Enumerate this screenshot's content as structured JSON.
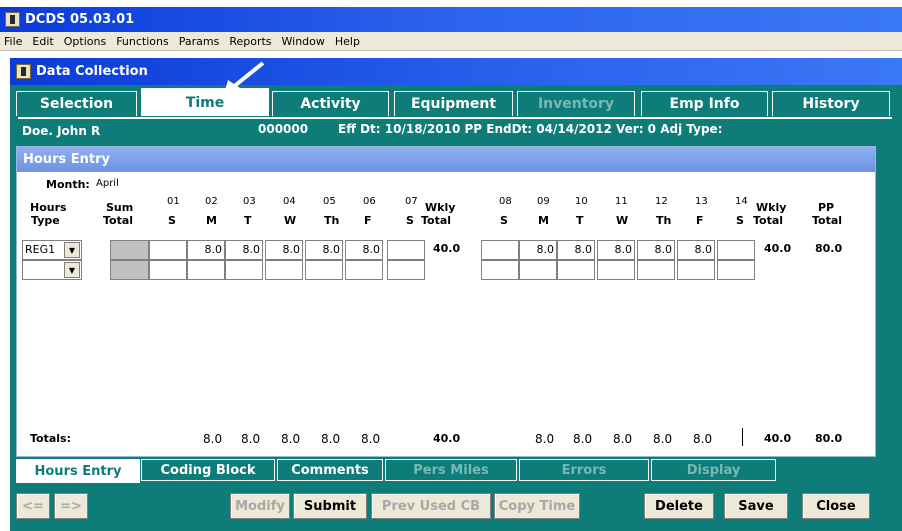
{
  "app": {
    "title": "DCDS 05.03.01"
  },
  "menu": [
    "File",
    "Edit",
    "Options",
    "Functions",
    "Params",
    "Reports",
    "Window",
    "Help"
  ],
  "child_window": {
    "title": "Data Collection"
  },
  "tabs": [
    {
      "label": "Selection",
      "state": "normal"
    },
    {
      "label": "Time",
      "state": "active"
    },
    {
      "label": "Activity",
      "state": "normal"
    },
    {
      "label": "Equipment",
      "state": "normal"
    },
    {
      "label": "Inventory",
      "state": "disabled"
    },
    {
      "label": "Emp Info",
      "state": "normal"
    },
    {
      "label": "History",
      "state": "normal"
    }
  ],
  "employee": {
    "name": "Doe. John R",
    "id": "000000",
    "details": "Eff Dt: 10/18/2010  PP EndDt: 04/14/2012  Ver:  0  Adj Type:"
  },
  "hours_entry": {
    "title": "Hours Entry",
    "month_label": "Month:",
    "month_value": "April",
    "headers": {
      "hours_type_1": "Hours",
      "hours_type_2": "Type",
      "sum_total_1": "Sum",
      "sum_total_2": "Total",
      "wkly_total_1": "Wkly",
      "wkly_total_2": "Total",
      "pp_total_1": "PP",
      "pp_total_2": "Total"
    },
    "week1_days": [
      {
        "num": "01",
        "day": "S"
      },
      {
        "num": "02",
        "day": "M"
      },
      {
        "num": "03",
        "day": "T"
      },
      {
        "num": "04",
        "day": "W"
      },
      {
        "num": "05",
        "day": "Th"
      },
      {
        "num": "06",
        "day": "F"
      },
      {
        "num": "07",
        "day": "S"
      }
    ],
    "week2_days": [
      {
        "num": "08",
        "day": "S"
      },
      {
        "num": "09",
        "day": "M"
      },
      {
        "num": "10",
        "day": "T"
      },
      {
        "num": "11",
        "day": "W"
      },
      {
        "num": "12",
        "day": "Th"
      },
      {
        "num": "13",
        "day": "F"
      },
      {
        "num": "14",
        "day": "S"
      }
    ],
    "rows": [
      {
        "type": "REG1",
        "week1": [
          "",
          "8.0",
          "8.0",
          "8.0",
          "8.0",
          "8.0",
          ""
        ],
        "wkly1": "40.0",
        "week2": [
          "",
          "8.0",
          "8.0",
          "8.0",
          "8.0",
          "8.0",
          ""
        ],
        "wkly2": "40.0",
        "pp_total": "80.0"
      },
      {
        "type": "",
        "week1": [
          "",
          "",
          "",
          "",
          "",
          "",
          ""
        ],
        "wkly1": "",
        "week2": [
          "",
          "",
          "",
          "",
          "",
          "",
          ""
        ],
        "wkly2": "",
        "pp_total": ""
      }
    ],
    "totals": {
      "label": "Totals:",
      "week1": [
        "",
        "8.0",
        "8.0",
        "8.0",
        "8.0",
        "8.0",
        ""
      ],
      "wkly1": "40.0",
      "week2": [
        "",
        "8.0",
        "8.0",
        "8.0",
        "8.0",
        "8.0",
        ""
      ],
      "wkly2": "40.0",
      "pp_total": "80.0"
    }
  },
  "bottom_tabs": [
    {
      "label": "Hours Entry",
      "state": "active"
    },
    {
      "label": "Coding Block",
      "state": "normal"
    },
    {
      "label": "Comments",
      "state": "normal"
    },
    {
      "label": "Pers Miles",
      "state": "disabled"
    },
    {
      "label": "Errors",
      "state": "disabled"
    },
    {
      "label": "Display",
      "state": "disabled"
    }
  ],
  "buttons": {
    "prev": "<=",
    "next": "=>",
    "modify": "Modify",
    "submit": "Submit",
    "prev_used_cb": "Prev Used CB",
    "copy_time": "Copy Time",
    "delete": "Delete",
    "save": "Save",
    "close": "Close"
  },
  "colors": {
    "teal": "#0e7c78",
    "title_blue": "#0a3bd9",
    "panel_blue": "#7a9ae6"
  }
}
